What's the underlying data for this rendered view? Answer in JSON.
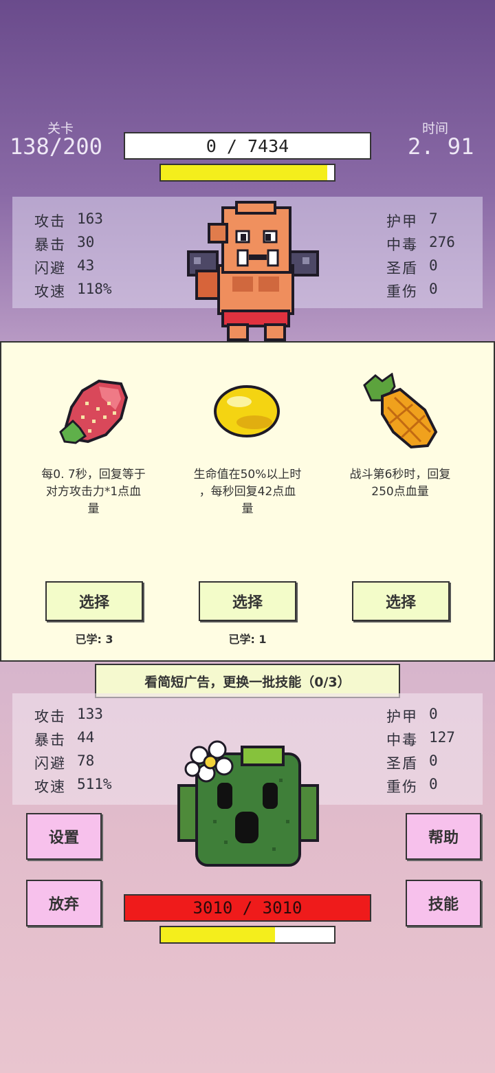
{
  "header": {
    "level_label": "关卡",
    "level_value": "138/200",
    "time_label": "时间",
    "time_value": "2. 91",
    "enemy_hp_text": "0  /  7434",
    "enemy_timer_fill": 0.96
  },
  "enemy_stats": {
    "left": [
      {
        "k": "攻击",
        "v": "163"
      },
      {
        "k": "暴击",
        "v": "30"
      },
      {
        "k": "闪避",
        "v": "43"
      },
      {
        "k": "攻速",
        "v": "118%"
      }
    ],
    "right": [
      {
        "k": "护甲",
        "v": "7"
      },
      {
        "k": "中毒",
        "v": "276"
      },
      {
        "k": "圣盾",
        "v": "0"
      },
      {
        "k": "重伤",
        "v": "0"
      }
    ]
  },
  "skills": [
    {
      "icon": "strawberry-icon",
      "desc": [
        "每0. 7秒，回复等于",
        "对方攻击力*1点血",
        "量"
      ],
      "button": "选择",
      "learned": "已学: 3"
    },
    {
      "icon": "lemon-icon",
      "desc": [
        "生命值在50%以上时",
        "，每秒回复42点血",
        "量"
      ],
      "button": "选择",
      "learned": "已学: 1"
    },
    {
      "icon": "pineapple-icon",
      "desc": [
        "战斗第6秒时，回复",
        "250点血量"
      ],
      "button": "选择",
      "learned": ""
    }
  ],
  "ad_button": "看简短广告，更换一批技能（0/3）",
  "player_stats": {
    "left": [
      {
        "k": "攻击",
        "v": "133"
      },
      {
        "k": "暴击",
        "v": "44"
      },
      {
        "k": "闪避",
        "v": "78"
      },
      {
        "k": "攻速",
        "v": "511%"
      }
    ],
    "right": [
      {
        "k": "护甲",
        "v": "0"
      },
      {
        "k": "中毒",
        "v": "127"
      },
      {
        "k": "圣盾",
        "v": "0"
      },
      {
        "k": "重伤",
        "v": "0"
      }
    ]
  },
  "buttons": {
    "settings": "设置",
    "help": "帮助",
    "give_up": "放弃",
    "skills": "技能"
  },
  "player_hp_text": "3010  /  3010",
  "player_timer_fill": 0.66,
  "colors": {
    "hp_red": "#ef1b1b",
    "timer_yellow": "#f4ee1c",
    "pink_button": "#f7c1ec",
    "card_bg": "#fffde3"
  }
}
